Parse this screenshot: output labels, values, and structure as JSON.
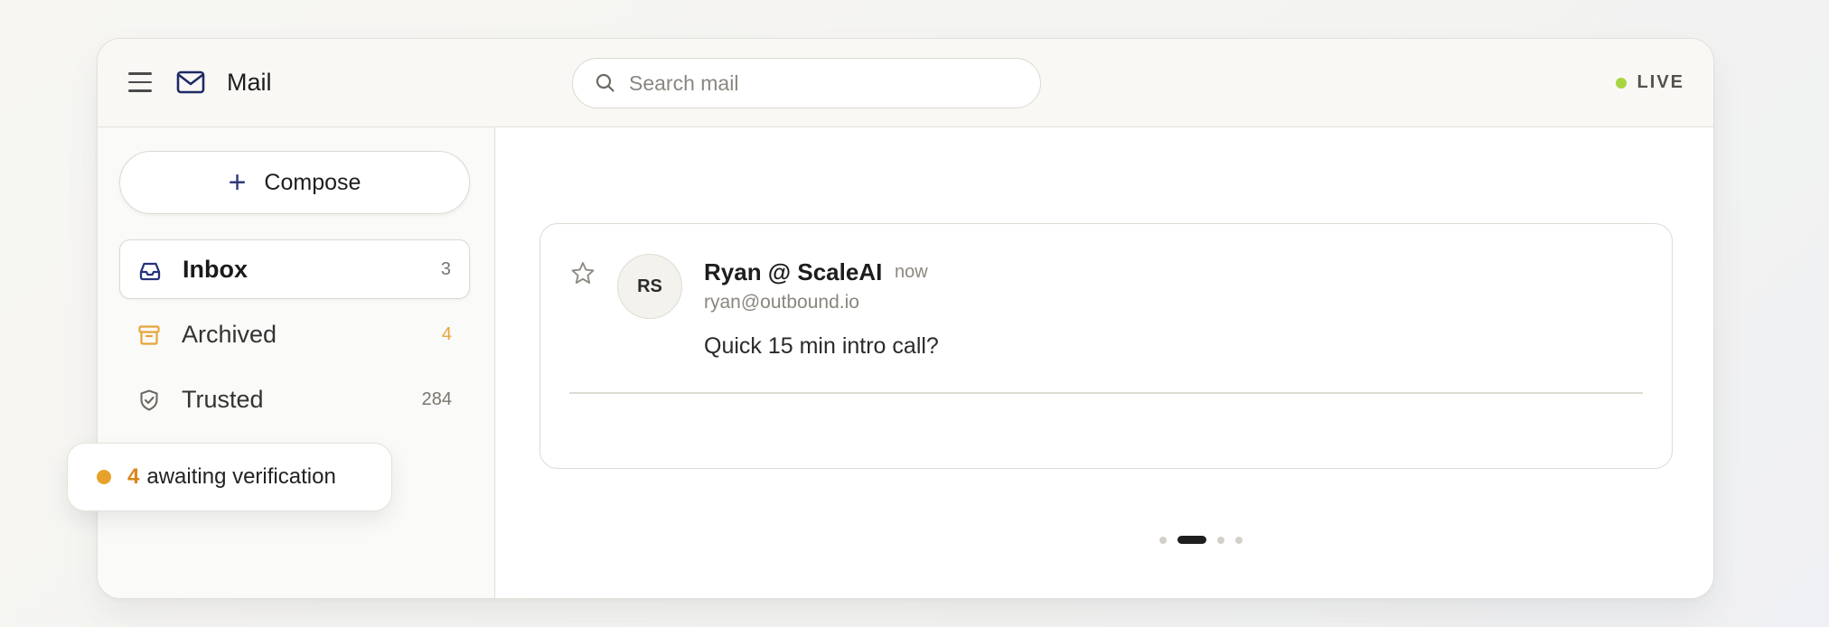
{
  "header": {
    "app_title": "Mail",
    "search_placeholder": "Search mail",
    "status_label": "LIVE",
    "status_color": "#a6d640"
  },
  "sidebar": {
    "compose_label": "Compose",
    "items": [
      {
        "label": "Inbox",
        "count": "3",
        "icon": "inbox-icon",
        "active": true
      },
      {
        "label": "Archived",
        "count": "4",
        "icon": "archive-icon",
        "count_color": "#e6a53a"
      },
      {
        "label": "Trusted",
        "count": "284",
        "icon": "shield-check-icon"
      }
    ]
  },
  "toast": {
    "count": "4",
    "text": "awaiting verification",
    "dot_color": "#e8a22c"
  },
  "message": {
    "avatar_initials": "RS",
    "sender": "Ryan @ ScaleAI",
    "time": "now",
    "email": "ryan@outbound.io",
    "subject": "Quick 15 min intro call?"
  },
  "pager": {
    "total": 4,
    "active_index": 1
  }
}
